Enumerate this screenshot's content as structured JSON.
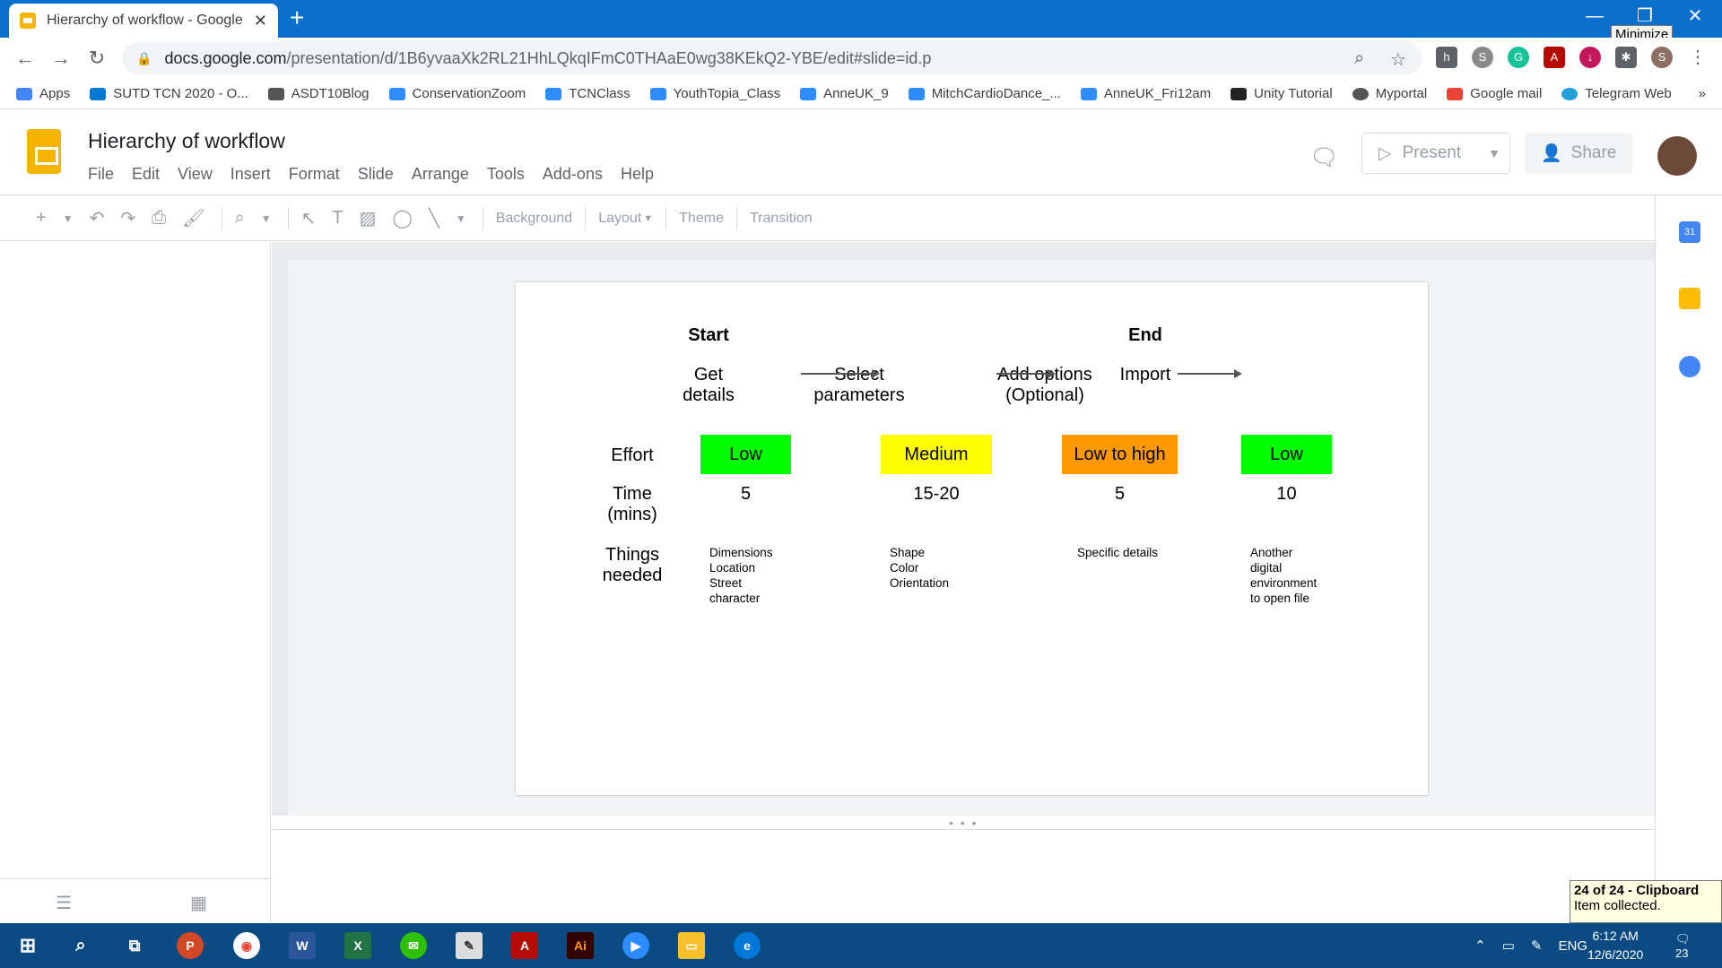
{
  "browser": {
    "tab_title": "Hierarchy of workflow - Google S",
    "tooltip": "Minimize",
    "url_host": "docs.google.com",
    "url_path": "/presentation/d/1B6yvaaXk2RL21HhLQkqIFmC0THAaE0wg38KEkQ2-YBE/edit#slide=id.p"
  },
  "bookmarks": [
    {
      "label": "Apps",
      "color": "#4285f4"
    },
    {
      "label": "SUTD TCN 2020 - O...",
      "color": "#0078d4"
    },
    {
      "label": "ASDT10Blog",
      "color": "#555555"
    },
    {
      "label": "ConservationZoom",
      "color": "#2d8cff"
    },
    {
      "label": "TCNClass",
      "color": "#2d8cff"
    },
    {
      "label": "YouthTopia_Class",
      "color": "#2d8cff"
    },
    {
      "label": "AnneUK_9",
      "color": "#2d8cff"
    },
    {
      "label": "MitchCardioDance_...",
      "color": "#2d8cff"
    },
    {
      "label": "AnneUK_Fri12am",
      "color": "#2d8cff"
    },
    {
      "label": "Unity Tutorial",
      "color": "#222222"
    },
    {
      "label": "Myportal",
      "color": "#555555"
    },
    {
      "label": "Google mail",
      "color": "#ea4335"
    },
    {
      "label": "Telegram Web",
      "color": "#229ed9"
    }
  ],
  "doc": {
    "title": "Hierarchy of workflow",
    "menu": [
      "File",
      "Edit",
      "View",
      "Insert",
      "Format",
      "Slide",
      "Arrange",
      "Tools",
      "Add-ons",
      "Help"
    ],
    "present_label": "Present",
    "share_label": "Share"
  },
  "toolbar": {
    "background": "Background",
    "layout": "Layout",
    "theme": "Theme",
    "transition": "Transition"
  },
  "slide": {
    "start_label": "Start",
    "end_label": "End",
    "steps": [
      {
        "line1": "Get",
        "line2": "details"
      },
      {
        "line1": "Select",
        "line2": "parameters"
      },
      {
        "line1": "Add options",
        "line2": "(Optional)"
      },
      {
        "line1": "Import",
        "line2": ""
      }
    ],
    "effort_label": "Effort",
    "effort": [
      {
        "text": "Low",
        "color": "#00ff00"
      },
      {
        "text": "Medium",
        "color": "#ffff00"
      },
      {
        "text": "Low to high",
        "color": "#ff9900"
      },
      {
        "text": "Low",
        "color": "#00ff00"
      }
    ],
    "time_label_1": "Time",
    "time_label_2": "(mins)",
    "times": [
      "5",
      "15-20",
      "5",
      "10"
    ],
    "things_label_1": "Things",
    "things_label_2": "needed",
    "things": [
      [
        "Dimensions",
        "Location",
        "Street",
        "character"
      ],
      [
        "Shape",
        "Color",
        "Orientation"
      ],
      [
        "Specific details"
      ],
      [
        "Another",
        "digital",
        "environment",
        "to open file"
      ]
    ]
  },
  "clipboard": {
    "title": "24 of 24 - Clipboard",
    "message": "Item collected."
  },
  "taskbar": {
    "lang": "ENG",
    "time": "6:12 AM",
    "date": "12/6/2020",
    "notifications": "23"
  }
}
